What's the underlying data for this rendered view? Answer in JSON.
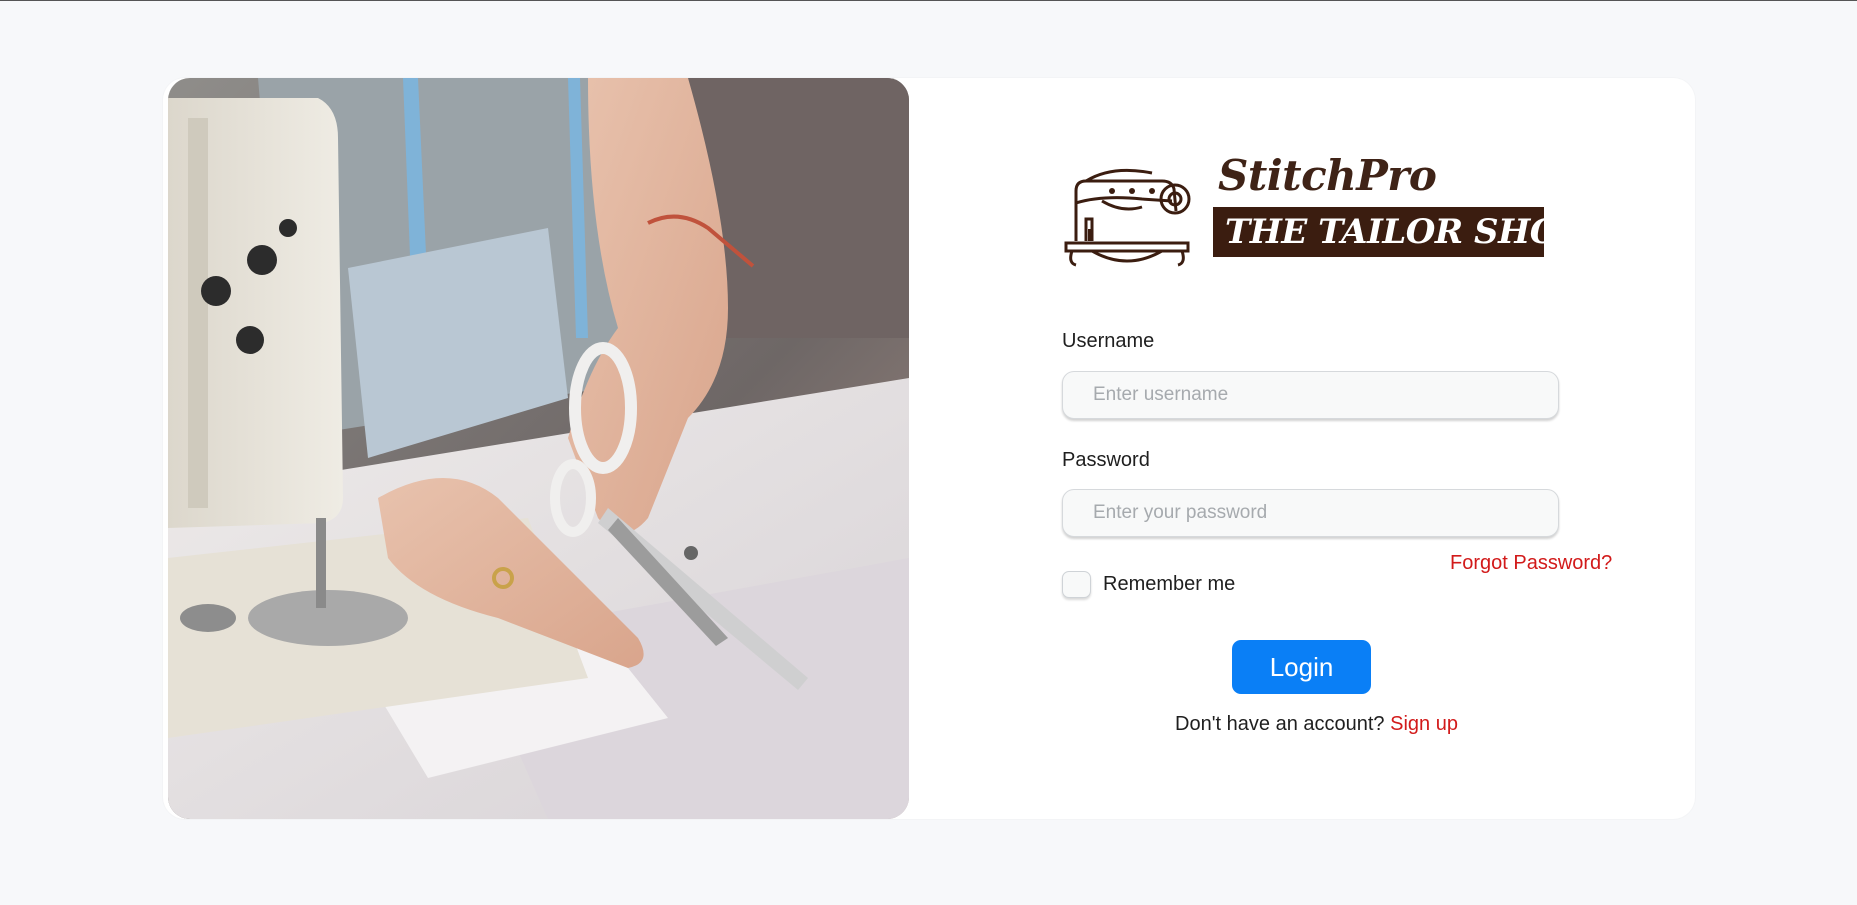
{
  "brand": {
    "name": "StitchPro",
    "tagline": "THE TAILOR SHOP",
    "logo_icon": "sewing-machine-icon",
    "colors": {
      "dark_brown": "#3b1d10"
    }
  },
  "form": {
    "username_label": "Username",
    "username_placeholder": "Enter username",
    "username_value": "",
    "password_label": "Password",
    "password_placeholder": "Enter your password",
    "password_value": "",
    "forgot_label": "Forgot Password?",
    "remember_label": "Remember me",
    "remember_checked": false,
    "login_label": "Login",
    "signup_prompt": "Don't have an account?",
    "signup_label": "Sign up"
  },
  "colors": {
    "primary": "#0a7ff6",
    "link": "#d21a1a",
    "page_bg": "#f7f8fa"
  }
}
